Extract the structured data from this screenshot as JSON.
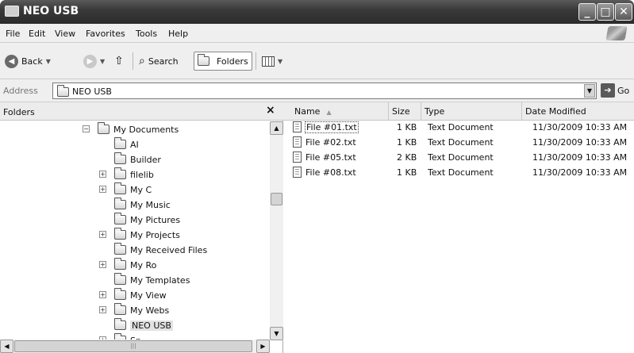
{
  "window": {
    "title": "NEO USB"
  },
  "menu": [
    "File",
    "Edit",
    "View",
    "Favorites",
    "Tools",
    "Help"
  ],
  "toolbar": {
    "back": "Back",
    "search": "Search",
    "folders": "Folders"
  },
  "address": {
    "label": "Address",
    "value": "NEO USB",
    "go": "Go"
  },
  "folders_pane": {
    "title": "Folders",
    "close": "×",
    "tree": [
      {
        "label": "My Documents",
        "expander": "−",
        "selected": false
      },
      {
        "label": "AI",
        "expander": "",
        "selected": false
      },
      {
        "label": "Builder",
        "expander": "",
        "selected": false
      },
      {
        "label": "filelib",
        "expander": "+",
        "selected": false
      },
      {
        "label": "My C",
        "expander": "+",
        "selected": false
      },
      {
        "label": "My Music",
        "expander": "",
        "selected": false
      },
      {
        "label": "My Pictures",
        "expander": "",
        "selected": false
      },
      {
        "label": "My Projects",
        "expander": "+",
        "selected": false
      },
      {
        "label": "My Received Files",
        "expander": "",
        "selected": false
      },
      {
        "label": "My Ro",
        "expander": "+",
        "selected": false
      },
      {
        "label": "My Templates",
        "expander": "",
        "selected": false
      },
      {
        "label": "My View",
        "expander": "+",
        "selected": false
      },
      {
        "label": "My Webs",
        "expander": "+",
        "selected": false
      },
      {
        "label": "NEO USB",
        "expander": "",
        "selected": true
      },
      {
        "label": "Sp",
        "expander": "+",
        "selected": false
      }
    ]
  },
  "files": {
    "columns": {
      "name": "Name",
      "size": "Size",
      "type": "Type",
      "modified": "Date Modified"
    },
    "rows": [
      {
        "name": "File #01.txt",
        "size": "1 KB",
        "type": "Text Document",
        "modified": "11/30/2009 10:33 AM"
      },
      {
        "name": "File #02.txt",
        "size": "1 KB",
        "type": "Text Document",
        "modified": "11/30/2009 10:33 AM"
      },
      {
        "name": "File #05.txt",
        "size": "2 KB",
        "type": "Text Document",
        "modified": "11/30/2009 10:33 AM"
      },
      {
        "name": "File #08.txt",
        "size": "1 KB",
        "type": "Text Document",
        "modified": "11/30/2009 10:33 AM"
      }
    ]
  }
}
